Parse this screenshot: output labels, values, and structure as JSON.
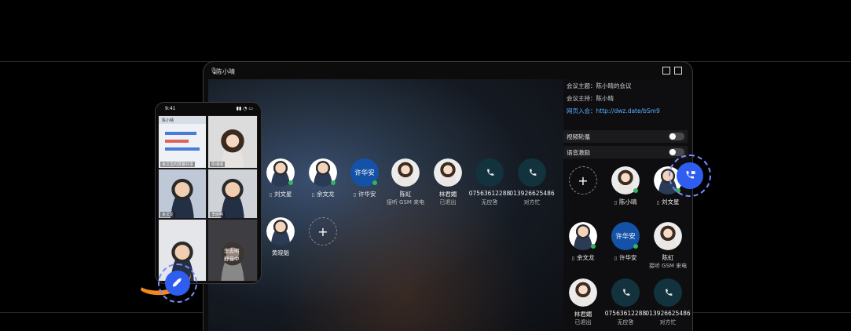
{
  "tablet": {
    "title": "陈小晴",
    "info": {
      "topic": "会议主题：陈小晴的会议",
      "host": "会议主持：陈小晴",
      "web_join": "网页入会：http://dwz.date/bSm9"
    },
    "toggles": [
      {
        "label": "视频轮循",
        "on": false
      },
      {
        "label": "语音激励",
        "on": false
      }
    ],
    "stage_participants": [
      {
        "name": "刘文星",
        "status": "",
        "kind": "photo",
        "gender": "male",
        "device": "phone"
      },
      {
        "name": "余文龙",
        "status": "",
        "kind": "photo",
        "gender": "male",
        "device": "phone"
      },
      {
        "name": "许华安",
        "status": "",
        "kind": "text",
        "avatar_text": "许华安",
        "device": "phone"
      },
      {
        "name": "陈虹",
        "status": "接听 GSM 来电",
        "kind": "photo",
        "gender": "female",
        "device": ""
      },
      {
        "name": "林君媚",
        "status": "已退出",
        "kind": "photo",
        "gender": "female",
        "device": ""
      },
      {
        "name": "07563612288",
        "status": "无应答",
        "kind": "phone",
        "device": ""
      },
      {
        "name": "013926625486",
        "status": "对方忙",
        "kind": "phone",
        "device": ""
      },
      {
        "name": "黄晓魁",
        "status": "",
        "kind": "photo",
        "gender": "male",
        "device": ""
      }
    ],
    "side_participants": [
      {
        "name": "陈小晴",
        "status": "",
        "kind": "photo",
        "gender": "female",
        "device": "phone"
      },
      {
        "name": "刘文星",
        "status": "",
        "kind": "photo",
        "gender": "male",
        "device": "phone"
      },
      {
        "name": "余文龙",
        "status": "",
        "kind": "photo",
        "gender": "male",
        "device": "phone"
      },
      {
        "name": "许华安",
        "status": "",
        "kind": "text",
        "avatar_text": "许华安",
        "device": "phone"
      },
      {
        "name": "陈虹",
        "status": "接听 GSM 来电",
        "kind": "photo",
        "gender": "female",
        "device": ""
      },
      {
        "name": "林君媚",
        "status": "已退出",
        "kind": "photo",
        "gender": "female",
        "device": ""
      },
      {
        "name": "07563612288",
        "status": "无应答",
        "kind": "phone",
        "device": ""
      },
      {
        "name": "013926625486",
        "status": "对方忙",
        "kind": "phone",
        "device": ""
      }
    ]
  },
  "phone": {
    "time": "9:41",
    "status_icons": "▮▮ ◔ ▭",
    "header": "陈小晴",
    "tiles": [
      "余文龙的屏幕共享",
      "陈瑞瑞",
      "余文龙",
      "李晓明",
      "",
      "李志明\n静音中"
    ]
  },
  "icons": {
    "add": "+",
    "mic": "🎙",
    "device_phone": "▯"
  },
  "colors": {
    "accent_blue": "#2f5df0",
    "link": "#5aaeff",
    "mic_green": "#31b45c",
    "orange": "#f08a1d"
  }
}
